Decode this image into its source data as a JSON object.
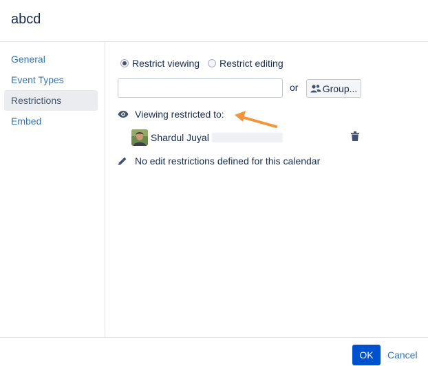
{
  "dialog": {
    "title": "abcd"
  },
  "sidebar": {
    "items": [
      {
        "label": "General"
      },
      {
        "label": "Event Types"
      },
      {
        "label": "Restrictions"
      },
      {
        "label": "Embed"
      }
    ]
  },
  "restrictions": {
    "radio_view_label": "Restrict viewing",
    "radio_edit_label": "Restrict editing",
    "selected_mode": "Restrict viewing",
    "search_value": "",
    "or_label": "or",
    "group_button_label": "Group...",
    "viewing_label": "Viewing restricted to:",
    "user": {
      "name": "Shardul Juyal"
    },
    "edit_message": "No edit restrictions defined for this calendar"
  },
  "footer": {
    "ok_label": "OK",
    "cancel_label": "Cancel"
  },
  "colors": {
    "accent": "#0052cc",
    "link": "#3572b0",
    "arrow": "#f0963c",
    "active_nav_bg": "#ebecf0"
  },
  "icons": [
    "eye-icon",
    "pencil-icon",
    "users-icon",
    "trash-icon",
    "arrow-annotation"
  ]
}
